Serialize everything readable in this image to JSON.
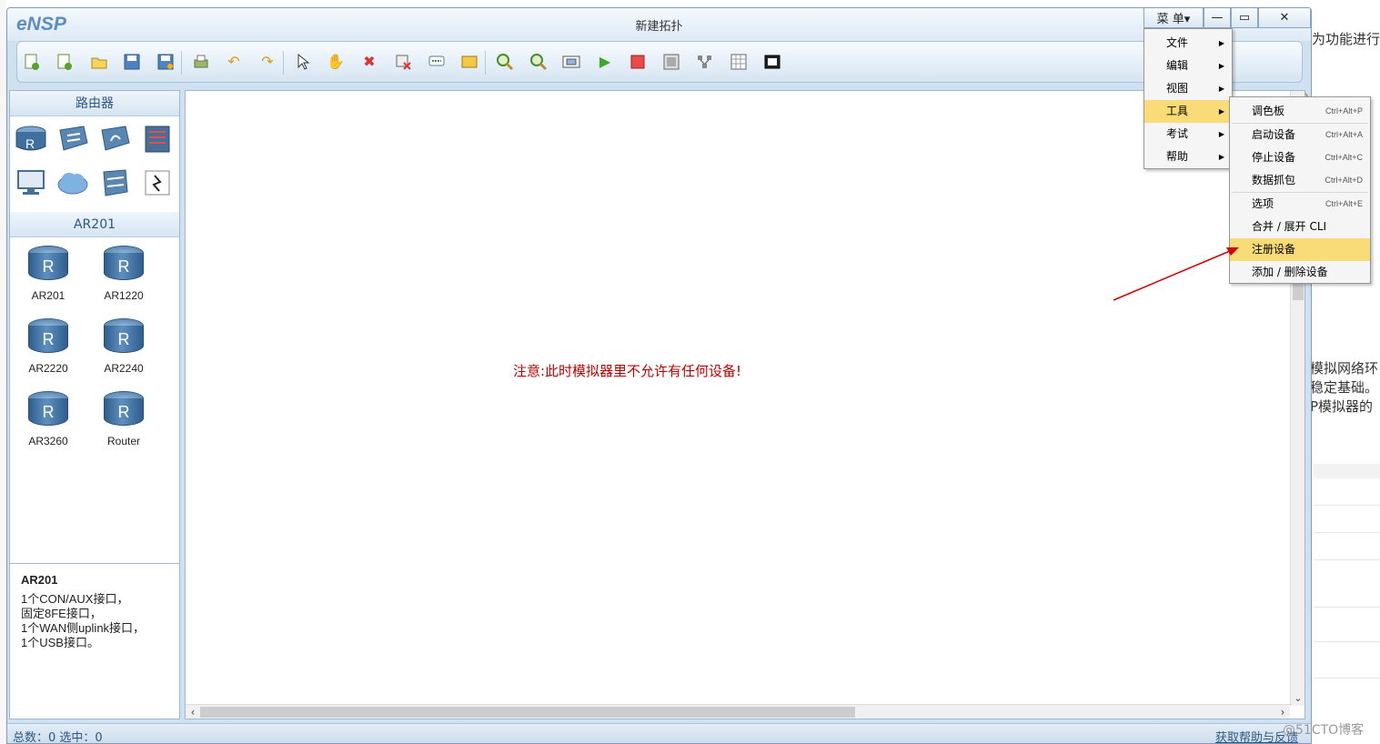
{
  "window": {
    "app_name": "eNSP",
    "title": "新建拓扑",
    "menu_button": "菜 单▾",
    "minimize": "—",
    "maximize": "▭",
    "close": "✕"
  },
  "toolbar": {
    "icons": [
      "new-topology-icon",
      "new-blank-icon",
      "open-icon",
      "save-icon",
      "save-as-icon",
      "print-icon",
      "undo-icon",
      "redo-icon",
      "select-icon",
      "pan-icon",
      "delete-icon",
      "delete-link-icon",
      "text-icon",
      "rectangle-icon",
      "zoom-in-icon",
      "zoom-out-icon",
      "fit-icon",
      "start-icon",
      "stop-icon",
      "capture-icon",
      "topology-icon",
      "grid-icon",
      "screenshot-icon"
    ]
  },
  "device_panel": {
    "category_header": "路由器",
    "category_icons": [
      "router-category-icon",
      "switch-category-icon",
      "wireless-category-icon",
      "firewall-category-icon",
      "pc-category-icon",
      "cloud-category-icon",
      "other-device-icon",
      "link-icon"
    ],
    "sub_header": "AR201",
    "devices": [
      {
        "label": "AR201"
      },
      {
        "label": "AR1220"
      },
      {
        "label": "AR2220"
      },
      {
        "label": "AR2240"
      },
      {
        "label": "AR3260"
      },
      {
        "label": "Router"
      }
    ]
  },
  "info": {
    "title": "AR201",
    "lines": [
      "1个CON/AUX接口，",
      "固定8FE接口，",
      "1个WAN侧uplink接口，",
      "1个USB接口。"
    ]
  },
  "canvas": {
    "notice": "注意:此时模拟器里不允许有任何设备!"
  },
  "status": {
    "counts": "总数：0  选中：0",
    "help_link": "获取帮助与反馈"
  },
  "main_menu": {
    "items": [
      {
        "label": "文件"
      },
      {
        "label": "编辑"
      },
      {
        "label": "视图"
      },
      {
        "label": "工具"
      },
      {
        "label": "考试"
      },
      {
        "label": "帮助"
      }
    ]
  },
  "tools_menu": {
    "items": [
      {
        "label": "调色板",
        "shortcut": "Ctrl+Alt+P"
      },
      {
        "label": "启动设备",
        "shortcut": "Ctrl+Alt+A"
      },
      {
        "label": "停止设备",
        "shortcut": "Ctrl+Alt+C"
      },
      {
        "label": "数据抓包",
        "shortcut": "Ctrl+Alt+D"
      },
      {
        "label": "选项",
        "shortcut": "Ctrl+Alt+E"
      },
      {
        "label": "合并 / 展开 CLI",
        "shortcut": ""
      },
      {
        "label": "注册设备",
        "shortcut": ""
      },
      {
        "label": "添加 / 删除设备",
        "shortcut": ""
      }
    ]
  },
  "background_page": {
    "text1": "为功能进行",
    "text2": "模拟网络环",
    "text3": "稳定基础。",
    "text4": "P模拟器的",
    "watermark": "@51CTO博客"
  },
  "colors": {
    "notice": "#c00000",
    "menu_highlight": "#f9dc77",
    "annotation_arrow": "#d40000"
  }
}
